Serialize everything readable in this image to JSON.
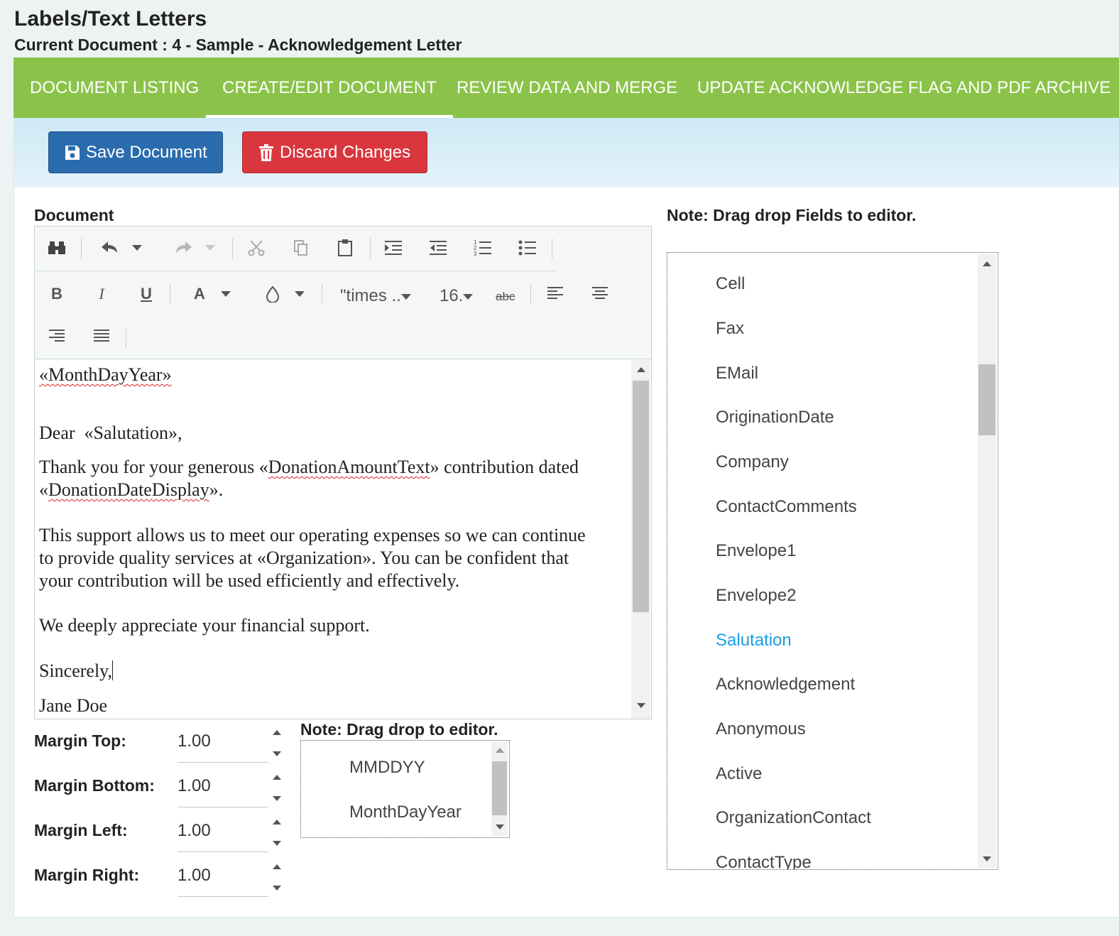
{
  "header": {
    "title": "Labels/Text Letters",
    "current_document": "Current Document : 4 - Sample - Acknowledgement Letter"
  },
  "tabs": [
    {
      "label": "DOCUMENT LISTING",
      "active": false
    },
    {
      "label": "CREATE/EDIT DOCUMENT",
      "active": true
    },
    {
      "label": "REVIEW DATA AND MERGE",
      "active": false
    },
    {
      "label": "UPDATE ACKNOWLEDGE FLAG AND PDF ARCHIVE",
      "active": false
    }
  ],
  "actions": {
    "save_label": "Save Document",
    "discard_label": "Discard Changes"
  },
  "editor": {
    "section_label": "Document",
    "font_name": "\"times ..",
    "font_size": "16.",
    "strike_label": "abc",
    "letter": {
      "date_field": "«MonthDayYear»",
      "dear": "Dear",
      "salutation_field": "«Salutation»,",
      "p1_a": "Thank you for your generous «",
      "p1_field1": "DonationAmountText",
      "p1_b": "» contribution dated",
      "p1_c": "«",
      "p1_field2": "DonationDateDisplay",
      "p1_d": "».",
      "p2_l1": "This support allows us to meet our operating expenses so we can continue",
      "p2_l2": "to provide quality services at «Organization».  You can be confident that",
      "p2_l3": "your contribution will be used efficiently and effectively.",
      "p3": "We deeply appreciate your financial support.",
      "closing": "Sincerely,",
      "signature": "Jane Doe"
    }
  },
  "margins": [
    {
      "label": "Margin Top:",
      "value": "1.00"
    },
    {
      "label": "Margin Bottom:",
      "value": "1.00"
    },
    {
      "label": "Margin Left:",
      "value": "1.00"
    },
    {
      "label": "Margin Right:",
      "value": "1.00"
    }
  ],
  "date_fields": {
    "note": "Note: Drag drop to editor.",
    "items": [
      "MMDDYY",
      "MonthDayYear"
    ]
  },
  "fields": {
    "note": "Note: Drag drop Fields to editor.",
    "items": [
      "Cell",
      "Fax",
      "EMail",
      "OriginationDate",
      "Company",
      "ContactComments",
      "Envelope1",
      "Envelope2",
      "Salutation",
      "Acknowledgement",
      "Anonymous",
      "Active",
      "OrganizationContact",
      "ContactType"
    ],
    "selected": "Salutation"
  },
  "colors": {
    "tab_bar": "#8bc34a",
    "save_button": "#2a6cae",
    "discard_button": "#d9363e",
    "selected_field": "#1a9ee2"
  }
}
